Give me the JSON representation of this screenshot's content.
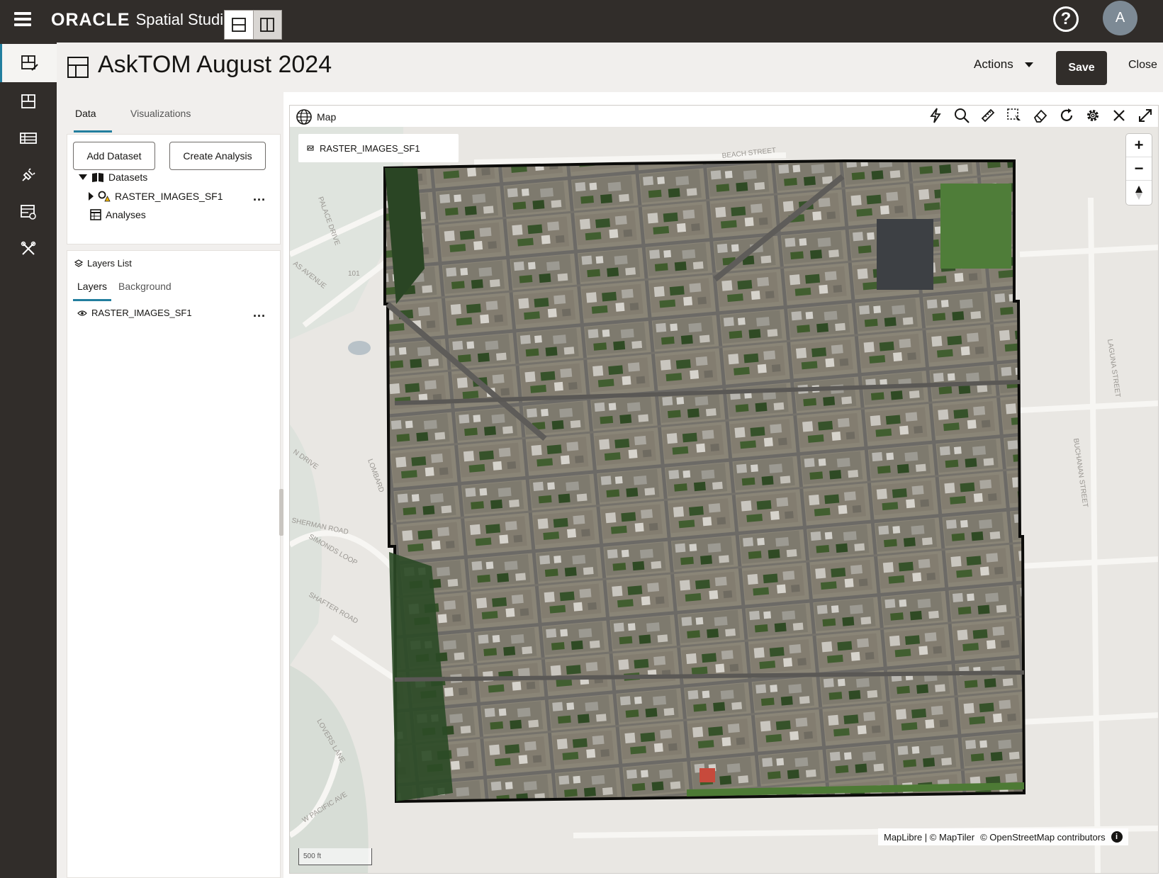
{
  "app": {
    "brand_oracle": "ORACLE",
    "brand_product": "Spatial Studio",
    "user_initial": "A",
    "help_glyph": "?"
  },
  "project": {
    "title": "AskTOM August 2024"
  },
  "header": {
    "actions_label": "Actions",
    "save_label": "Save",
    "close_label": "Close"
  },
  "left_panel": {
    "tabs": [
      {
        "label": "Data",
        "active": true
      },
      {
        "label": "Visualizations",
        "active": false
      }
    ],
    "add_dataset_label": "Add Dataset",
    "create_analysis_label": "Create Analysis",
    "tree": {
      "datasets_label": "Datasets",
      "dataset_item": "RASTER_IMAGES_SF1",
      "analyses_label": "Analyses"
    },
    "layers": {
      "title": "Layers List",
      "tab_layers": "Layers",
      "tab_background": "Background",
      "items": [
        {
          "label": "RASTER_IMAGES_SF1"
        }
      ]
    },
    "more_glyph": "···"
  },
  "map": {
    "title": "Map",
    "layer_chip": "RASTER_IMAGES_SF1",
    "zoom_in": "+",
    "zoom_out": "−",
    "attribution": {
      "maplibre": "MapLibre | © MapTiler",
      "osm": "© OpenStreetMap contributors",
      "info": "i"
    },
    "scale": "500 ft",
    "street_labels": [
      "BEACH STREET",
      "PALACE DRIVE",
      "101",
      "AS AVENUE",
      "LOMBARD",
      "N DRIVE",
      "SHERMAN ROAD",
      "SIMONDS LOOP",
      "SHAFTER ROAD",
      "LOVERS LANE",
      "W PACIFIC AVE",
      "LAGUNA STREET",
      "BUCHANAN STREET"
    ]
  },
  "colors": {
    "topbar": "#312d2a",
    "accent": "#227e9e",
    "panel_bg": "#f1efed",
    "map_bg": "#e8e6e2"
  }
}
